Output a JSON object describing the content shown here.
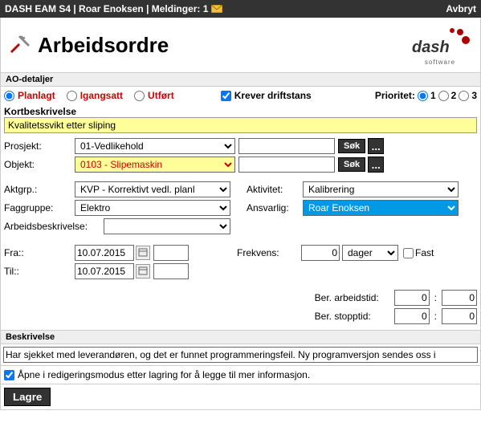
{
  "titlebar": {
    "left": "DASH EAM S4 | Roar Enoksen | Meldinger: 1",
    "right": "Avbryt"
  },
  "header": {
    "title": "Arbeidsordre",
    "logo_sub": "software"
  },
  "sections": {
    "ao": "AO-detaljer",
    "kb": "Kortbeskrivelse",
    "desc": "Beskrivelse"
  },
  "status": {
    "planlagt": "Planlagt",
    "igangsatt": "Igangsatt",
    "utfort": "Utført",
    "kreverdrift": "Krever driftstans",
    "prioritet": "Prioritet:",
    "p1": "1",
    "p2": "2",
    "p3": "3"
  },
  "kb_value": "Kvalitetssvikt etter sliping",
  "labels": {
    "prosjekt": "Prosjekt:",
    "objekt": "Objekt:",
    "aktgrp": "Aktgrp.:",
    "faggruppe": "Faggruppe:",
    "arbeidsbesk": "Arbeidsbeskrivelse:",
    "aktivitet": "Aktivitet:",
    "ansvarlig": "Ansvarlig:",
    "fra": "Fra::",
    "til": "Til::",
    "frekvens": "Frekvens:",
    "fast": "Fast",
    "ber_arb": "Ber. arbeidstid:",
    "ber_stopp": "Ber. stopptid:",
    "sok": "Søk",
    "dots": "..."
  },
  "values": {
    "prosjekt": "01-Vedlikehold",
    "objekt": "0103 - Slipemaskin",
    "aktgrp": "KVP - Korrektivt vedl. planl",
    "faggruppe": "Elektro",
    "aktivitet": "Kalibrering",
    "ansvarlig": "Roar Enoksen",
    "fra_date": "10.07.2015",
    "til_date": "10.07.2015",
    "frekvens": "0",
    "frekvens_unit": "dager",
    "ber_arb_h": "0",
    "ber_arb_m": "0",
    "ber_stopp_h": "0",
    "ber_stopp_m": "0"
  },
  "desc_text": "Har sjekket med leverandøren, og det er funnet programmeringsfeil. Ny programversjon sendes oss i",
  "open_edit": "Åpne i redigeringsmodus etter lagring for å legge til mer informasjon.",
  "lagre": "Lagre"
}
